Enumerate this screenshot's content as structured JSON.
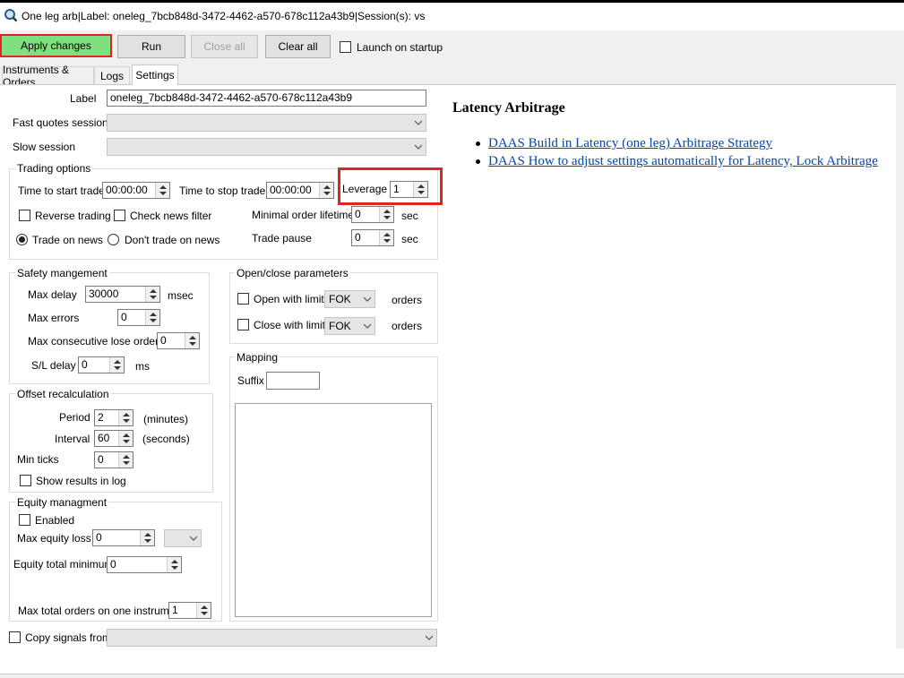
{
  "window": {
    "title": "One leg arb|Label: oneleg_7bcb848d-3472-4462-a570-678c112a43b9|Session(s):  vs",
    "icon": "magnifier-app-icon"
  },
  "toolbar": {
    "apply_label": "Apply changes",
    "run_label": "Run",
    "close_all_label": "Close all",
    "clear_all_label": "Clear all",
    "launch_on_startup_label": "Launch on startup",
    "launch_on_startup_checked": false
  },
  "tabs": [
    {
      "label": "Instruments & Orders",
      "active": false
    },
    {
      "label": "Logs",
      "active": false
    },
    {
      "label": "Settings",
      "active": true
    }
  ],
  "settings": {
    "label_caption": "Label",
    "label_value": "oneleg_7bcb848d-3472-4462-a570-678c112a43b9",
    "fast_quotes_caption": "Fast quotes session",
    "fast_quotes_value": "",
    "slow_session_caption": "Slow session",
    "slow_session_value": ""
  },
  "trading_options": {
    "title": "Trading options",
    "start_caption": "Time to start trade",
    "start_value": "00:00:00",
    "stop_caption": "Time to stop trade",
    "stop_value": "00:00:00",
    "leverage_caption": "Leverage",
    "leverage_value": "1",
    "reverse_trading": "Reverse trading",
    "check_news_filter": "Check news filter",
    "min_order_lifetime_caption": "Minimal order lifetime",
    "min_order_lifetime_value": "0",
    "min_order_lifetime_unit": "sec",
    "trade_on_news": "Trade on news",
    "dont_trade_on_news": "Don't trade on news",
    "trade_pause_caption": "Trade pause",
    "trade_pause_value": "0",
    "trade_pause_unit": "sec"
  },
  "safety": {
    "title": "Safety  mangement",
    "max_delay_caption": "Max delay",
    "max_delay_value": "30000",
    "max_delay_unit": "msec",
    "max_errors_caption": "Max errors",
    "max_errors_value": "0",
    "max_consec_caption": "Max consecutive lose orders",
    "max_consec_value": "0",
    "sl_delay_caption": "S/L delay",
    "sl_delay_value": "0",
    "sl_delay_unit": "ms"
  },
  "open_close": {
    "title": "Open/close parameters",
    "open_with_limit": "Open with limit",
    "open_type": "FOK",
    "open_orders": "orders",
    "close_with_limit": "Close with limit",
    "close_type": "FOK",
    "close_orders": "orders"
  },
  "offset": {
    "title": "Offset recalculation",
    "period_caption": "Period",
    "period_value": "2",
    "period_unit": "(minutes)",
    "interval_caption": "Interval",
    "interval_value": "60",
    "interval_unit": "(seconds)",
    "min_ticks_caption": "Min ticks",
    "min_ticks_value": "0",
    "show_results": "Show results in log"
  },
  "mapping": {
    "title": "Mapping",
    "suffix_caption": "Suffix",
    "suffix_value": ""
  },
  "equity": {
    "title": "Equity managment",
    "enabled": "Enabled",
    "max_equity_loss_caption": "Max equity loss",
    "max_equity_loss_value": "0",
    "equity_total_min_caption": "Equity total minimum",
    "equity_total_min_value": "0",
    "max_total_orders_caption": "Max total orders on one instrument",
    "max_total_orders_value": "1"
  },
  "copy_signals": {
    "caption": "Copy signals from",
    "value": ""
  },
  "info": {
    "title": "Latency Arbitrage",
    "links": [
      "DAAS Build in Latency (one leg) Arbitrage Strategy",
      "DAAS How to adjust settings automatically for Latency, Lock Arbitrage"
    ]
  },
  "colors": {
    "apply_bg": "#7fe07f",
    "highlight": "#e02424",
    "link": "#0645ad"
  }
}
